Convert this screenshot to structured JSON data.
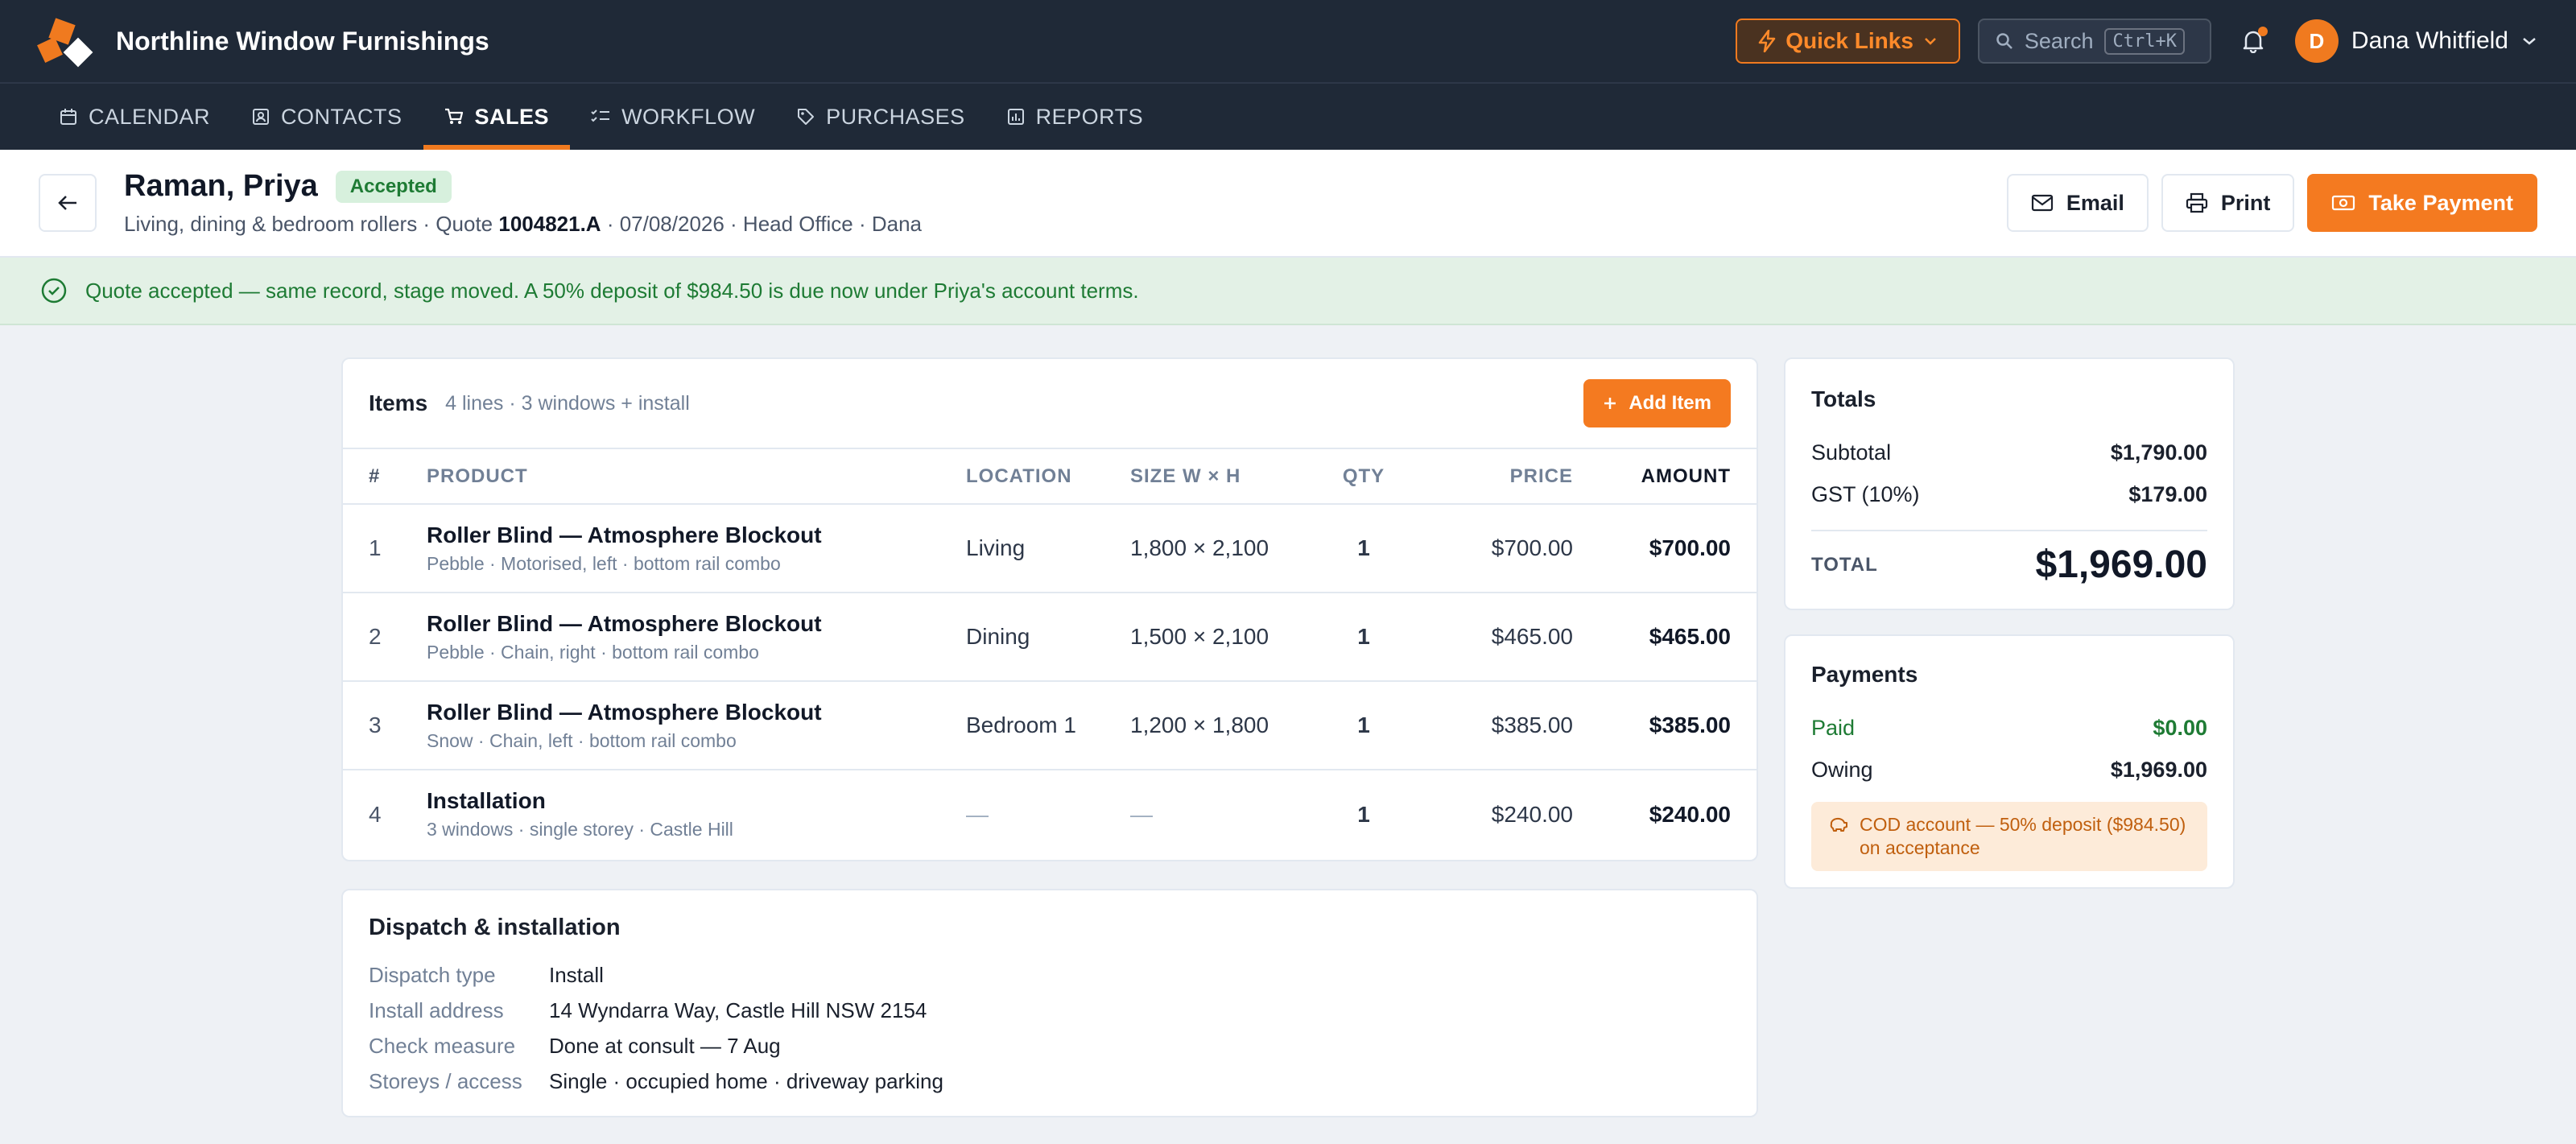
{
  "app": {
    "brand": "Northline Window Furnishings",
    "quick_links": "Quick Links",
    "search_placeholder": "Search",
    "search_shortcut": "Ctrl+K",
    "user_initial": "D",
    "user_name": "Dana Whitfield"
  },
  "nav": [
    {
      "label": "CALENDAR",
      "icon": "calendar-icon"
    },
    {
      "label": "CONTACTS",
      "icon": "contacts-icon"
    },
    {
      "label": "SALES",
      "icon": "cart-icon",
      "active": true
    },
    {
      "label": "WORKFLOW",
      "icon": "checklist-icon"
    },
    {
      "label": "PURCHASES",
      "icon": "tag-icon"
    },
    {
      "label": "REPORTS",
      "icon": "report-icon"
    }
  ],
  "header": {
    "title": "Raman, Priya",
    "status": "Accepted",
    "subtitle_prefix": "Living, dining & bedroom rollers · Quote ",
    "quote_number": "1004821.A",
    "subtitle_suffix": " · 07/08/2026 · Head Office · Dana",
    "email_label": "Email",
    "print_label": "Print",
    "take_payment_label": "Take Payment"
  },
  "banner": {
    "text": "Quote accepted — same record, stage moved. A 50% deposit of $984.50 is due now under Priya's account terms."
  },
  "items": {
    "title": "Items",
    "meta": "4 lines · 3 windows + install",
    "add_label": "Add Item",
    "columns": {
      "num": "#",
      "product": "PRODUCT",
      "location": "LOCATION",
      "size": "SIZE W × H",
      "qty": "QTY",
      "price": "PRICE",
      "amount": "AMOUNT"
    },
    "rows": [
      {
        "num": "1",
        "name": "Roller Blind — Atmosphere Blockout",
        "desc": "Pebble · Motorised, left · bottom rail combo",
        "location": "Living",
        "size": "1,800 × 2,100",
        "qty": "1",
        "price": "$700.00",
        "amount": "$700.00"
      },
      {
        "num": "2",
        "name": "Roller Blind — Atmosphere Blockout",
        "desc": "Pebble · Chain, right · bottom rail combo",
        "location": "Dining",
        "size": "1,500 × 2,100",
        "qty": "1",
        "price": "$465.00",
        "amount": "$465.00"
      },
      {
        "num": "3",
        "name": "Roller Blind — Atmosphere Blockout",
        "desc": "Snow · Chain, left · bottom rail combo",
        "location": "Bedroom 1",
        "size": "1,200 × 1,800",
        "qty": "1",
        "price": "$385.00",
        "amount": "$385.00"
      },
      {
        "num": "4",
        "name": "Installation",
        "desc": "3 windows · single storey · Castle Hill",
        "location": "—",
        "size": "—",
        "qty": "1",
        "price": "$240.00",
        "amount": "$240.00"
      }
    ]
  },
  "dispatch": {
    "title": "Dispatch & installation",
    "rows": [
      {
        "label": "Dispatch type",
        "value": "Install"
      },
      {
        "label": "Install address",
        "value": "14 Wyndarra Way, Castle Hill NSW 2154"
      },
      {
        "label": "Check measure",
        "value": "Done at consult — 7 Aug"
      },
      {
        "label": "Storeys / access",
        "value": "Single · occupied home · driveway parking"
      }
    ]
  },
  "totals": {
    "title": "Totals",
    "subtotal_label": "Subtotal",
    "subtotal": "$1,790.00",
    "gst_label": "GST (10%)",
    "gst": "$179.00",
    "total_label": "TOTAL",
    "total": "$1,969.00"
  },
  "payments": {
    "title": "Payments",
    "paid_label": "Paid",
    "paid": "$0.00",
    "owing_label": "Owing",
    "owing": "$1,969.00",
    "notice": "COD account — 50% deposit ($984.50) on acceptance"
  },
  "colors": {
    "accent": "#f47a20",
    "success": "#1e7b34",
    "navbar": "#1f2937"
  }
}
